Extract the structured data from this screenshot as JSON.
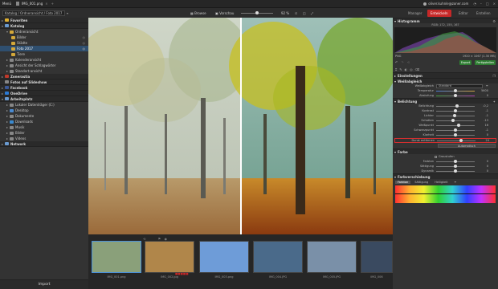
{
  "title_bar": {
    "menu": "Menü",
    "filename": "IMG_001.png",
    "user": "oliver.kuhnle@zoner.com"
  },
  "top": {
    "catalog_path": "Katalog / Ordneransicht / Foto 2017",
    "browse": "Browse",
    "preview": "Vorschau",
    "zoom": "92 %"
  },
  "mode_tabs": [
    "Manager",
    "Entwickeln",
    "Editor",
    "Erstellen"
  ],
  "active_tab": "Entwickeln",
  "left_panel": {
    "favorites": "Favoriten",
    "catalog": "Katalog",
    "ordner": "Ordneransicht",
    "folders": [
      "Bilder",
      "Städte",
      "Foto 2017",
      "Tiere"
    ],
    "kalender": "Kalenderansicht",
    "schlag": "Ansicht der Schlagwörter",
    "standort": "Standort-ansicht",
    "zonerastia": "Zonerastia",
    "fotos_auf_slideshow": "Fotos auf Slideshow",
    "facebook": "Facebook",
    "onedrive": "OneDrive",
    "arbeitsplatz": "Arbeitsplatz",
    "drives": [
      "Lokaler Datenträger (C:)",
      "Desktop",
      "Dokumente",
      "Downloads",
      "Musik",
      "Bilder",
      "Videos"
    ],
    "network": "Network",
    "import_label": "Import"
  },
  "right_panel": {
    "histogram": "Histogramm",
    "rgb_readout": "RGB: 172, 155, 167",
    "png_label": "PNG",
    "size_readout": "1920 × 1067 (1.30 MB)",
    "export": "Export",
    "finish": "Fertigstellen",
    "settings": "Einstellungen",
    "wb": "Weißabgleich",
    "wb_label": "Weißabgleich",
    "wb_value": "Standard",
    "temp_label": "Temperatur",
    "temp_value": "5600",
    "tint_label": "Abstufung",
    "tint_value": "0",
    "exposure": "Belichtung",
    "exposure_sliders": [
      {
        "label": "Belichtung",
        "value": "-0,2",
        "pos": 0.55
      },
      {
        "label": "Kontrast",
        "value": "-1",
        "pos": 0.49
      },
      {
        "label": "Lichter",
        "value": "-1",
        "pos": 0.48
      },
      {
        "label": "Schatten",
        "value": "-13",
        "pos": 0.44
      },
      {
        "label": "Weißpunkt",
        "value": "16",
        "pos": 0.58
      },
      {
        "label": "Schwarzpunkt",
        "value": "-1",
        "pos": 0.49
      },
      {
        "label": "Klarheit",
        "value": "0",
        "pos": 0.5
      }
    ],
    "dunst": {
      "label": "Dunst entfernen",
      "value": "24",
      "pos": 0.62
    },
    "auto": "Automatisch",
    "farbe": "Farbe",
    "graustufen": "Graustufen",
    "color_sliders": [
      {
        "label": "Farbton",
        "value": "0",
        "pos": 0.5
      },
      {
        "label": "Sättigung",
        "value": "0",
        "pos": 0.5
      },
      {
        "label": "Dynamik",
        "value": "0",
        "pos": 0.5
      }
    ],
    "farbverschiebung": "Farbverschiebung",
    "fv_tabs": [
      "Farbton",
      "Sättigung",
      "Helligkeit"
    ]
  },
  "filmstrip": [
    {
      "label": "IMG_001.png",
      "color": "#8aa07a"
    },
    {
      "label": "IMG_002.jpg",
      "color": "#b0864a"
    },
    {
      "label": "IMG_003.png",
      "color": "#6e9cd8"
    },
    {
      "label": "IMG_004.JPG",
      "color": "#4a6a8a"
    },
    {
      "label": "IMG_005.JPG",
      "color": "#7a90a8"
    },
    {
      "label": "IMG_006",
      "color": "#3a4a60"
    }
  ]
}
